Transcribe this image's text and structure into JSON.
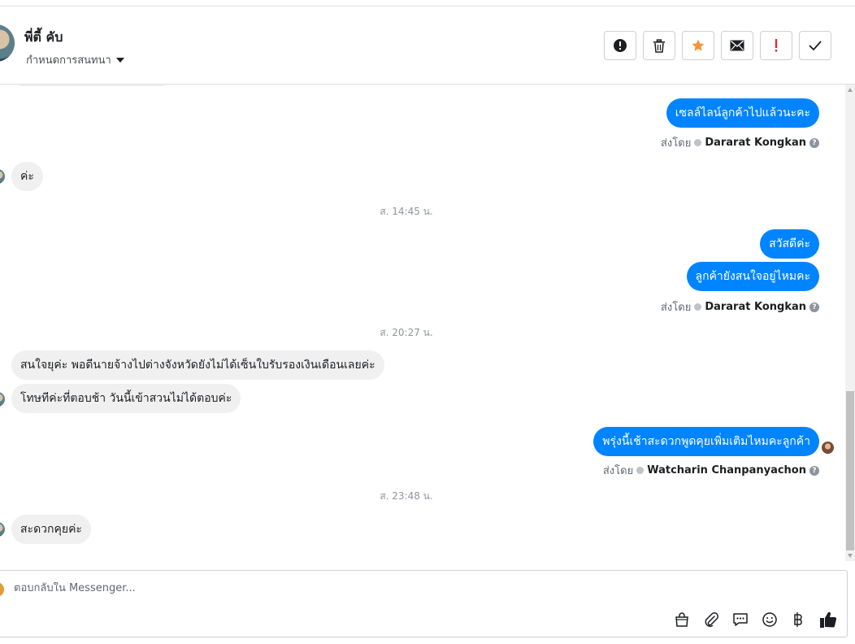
{
  "header": {
    "contact_name": "พี่ตี้ คับ",
    "assign_label": "กำหนดการสนทนา",
    "actions": [
      {
        "name": "report-spam-icon"
      },
      {
        "name": "trash-icon"
      },
      {
        "name": "star-icon",
        "color": "#f7923a"
      },
      {
        "name": "envelope-icon"
      },
      {
        "name": "follow-up-icon",
        "color": "#e02d2d"
      },
      {
        "name": "check-icon"
      }
    ]
  },
  "messages": {
    "m1_out": "เซลล์ไลน์ลูกค้าไปแล้วนะคะ",
    "m1_sentby_prefix": "ส่งโดย",
    "m1_agent": "Dararat Kongkan",
    "m2_in": "ค่ะ",
    "ts1": "ส. 14:45 น.",
    "m3_out": "สวัสดีค่ะ",
    "m4_out": "ลูกค้ายังสนใจอยู่ไหมคะ",
    "m4_sentby_prefix": "ส่งโดย",
    "m4_agent": "Dararat Kongkan",
    "ts2": "ส. 20:27 น.",
    "m5_in": "สนใจยุค่ะ พอดีนายจ้างไปต่างจังหวัดยังไม่ได้เซ็นใบรับรองเงินเดือนเลยค่ะ",
    "m6_in": "โทษทีค่ะที่ตอบช้า วันนี้เข้าสวนไม่ได้ตอบค่ะ",
    "m7_out": "พรุ่งนี้เช้าสะดวกพูดคุยเพิ่มเติมไหมคะลูกค้า",
    "m7_sentby_prefix": "ส่งโดย",
    "m7_agent": "Watcharin Chanpanyachon",
    "ts3": "ส. 23:48 น.",
    "m8_in": "สะดวกคุยค่ะ"
  },
  "composer": {
    "placeholder": "ตอบกลับใน Messenger...",
    "tools": [
      "shopping-bag-icon",
      "paperclip-icon",
      "saved-replies-icon",
      "emoji-icon",
      "baht-icon",
      "thumbs-up-icon"
    ]
  },
  "colors": {
    "outgoing_bubble": "#0084ff",
    "incoming_bubble": "#f0f0f0"
  }
}
